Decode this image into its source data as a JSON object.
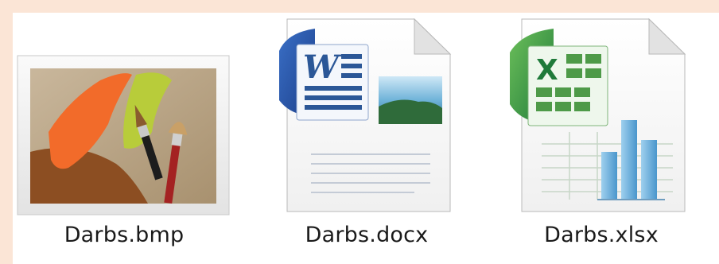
{
  "files": [
    {
      "name": "Darbs.bmp",
      "icon": "bitmap-image-icon"
    },
    {
      "name": "Darbs.docx",
      "icon": "word-document-icon"
    },
    {
      "name": "Darbs.xlsx",
      "icon": "excel-workbook-icon"
    }
  ],
  "colors": {
    "page_background": "#fbe5d6",
    "panel_background": "#ffffff",
    "word_accent": "#2b5797",
    "excel_accent": "#1f7a3a"
  }
}
